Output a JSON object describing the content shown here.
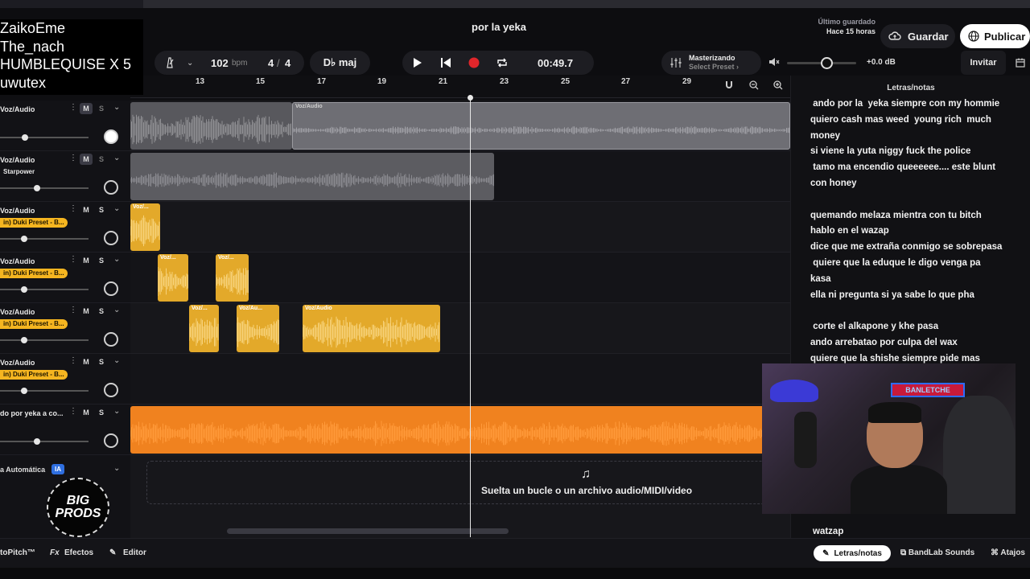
{
  "overlay_names": [
    "ZaikoEme",
    "The_nach",
    "HUMBLEQUISE X 5",
    "uwutex"
  ],
  "header": {
    "project_title": "por la yeka",
    "last_saved_label": "Último guardado",
    "last_saved_value": "Hace 15 horas",
    "save_label": "Guardar",
    "publish_label": "Publicar",
    "tempo_value": "102",
    "tempo_unit": "bpm",
    "time_sig_num": "4",
    "time_sig_den": "4",
    "key": "D♭ maj",
    "time_display": "00:49.7",
    "mastering_title": "Masterizando",
    "mastering_preset": "Select Preset ›",
    "volume_db": "+0.0 dB",
    "invite_label": "Invitar"
  },
  "ruler": {
    "ticks": [
      "13",
      "15",
      "17",
      "19",
      "21",
      "23",
      "25",
      "27",
      "29"
    ]
  },
  "tracks": [
    {
      "name": "Voz/Audio",
      "preset": "",
      "mute": "M",
      "solo": "S",
      "clips": [
        "Voz/Audio"
      ]
    },
    {
      "name": "Voz/Audio",
      "preset": "Starpower",
      "mute": "M",
      "solo": "S",
      "clips": []
    },
    {
      "name": "Voz/Audio",
      "preset": "in) Duki Preset - B...",
      "mute": "M",
      "solo": "S",
      "clips": [
        "Voz/..."
      ]
    },
    {
      "name": "Voz/Audio",
      "preset": "in) Duki Preset - B...",
      "mute": "M",
      "solo": "S",
      "clips": [
        "Voz/...",
        "Voz/..."
      ]
    },
    {
      "name": "Voz/Audio",
      "preset": "in) Duki Preset - B...",
      "mute": "M",
      "solo": "S",
      "clips": [
        "Voz/...",
        "Voz/Au...",
        "Voz/Audio"
      ]
    },
    {
      "name": "Voz/Audio",
      "preset": "in) Duki Preset - B...",
      "mute": "M",
      "solo": "S",
      "clips": []
    },
    {
      "name": "do por yeka a co...",
      "preset": "",
      "mute": "M",
      "solo": "S",
      "clips": []
    }
  ],
  "automation": {
    "label": "a Automática",
    "badge": "IA"
  },
  "logo_text": [
    "BIG",
    "PRODS"
  ],
  "drop_zone": "Suelta un bucle o un archivo audio/MIDI/video",
  "lyrics": {
    "title": "Letras/notas",
    "lines": [
      " ando por la  yeka siempre con my hommie",
      "quiero cash mas weed  young rich  much",
      "money",
      "si viene la yuta niggy fuck the police",
      " tamo ma encendio queeeeee.... este blunt",
      "con honey",
      "",
      "quemando melaza mientra con tu bitch",
      "hablo en el wazap",
      "dice que me extraña conmigo se sobrepasa",
      " quiere que la eduque le digo venga pa",
      "kasa",
      "ella ni pregunta si ya sabe lo que pha",
      "",
      " corte el alkapone y khe pasa",
      "ando arrebatao por culpa del wax",
      "quiere que la shishe siempre pide mas"
    ],
    "bottom_line": "watzap"
  },
  "webcam_sign": "BANLETCHE",
  "bottom_bar": {
    "autopitch": "toPitch™",
    "effects": "Efectos",
    "editor": "Editor",
    "lyrics_tab": "Letras/notas",
    "bandlab_sounds": "BandLab Sounds",
    "shortcuts": "Atajos"
  },
  "colors": {
    "clip_gold": "#e3a92a",
    "clip_orange": "#f0821f",
    "clip_gray": "#6e6e74",
    "record_red": "#e0262b",
    "ia_blue": "#2f6fe0"
  }
}
